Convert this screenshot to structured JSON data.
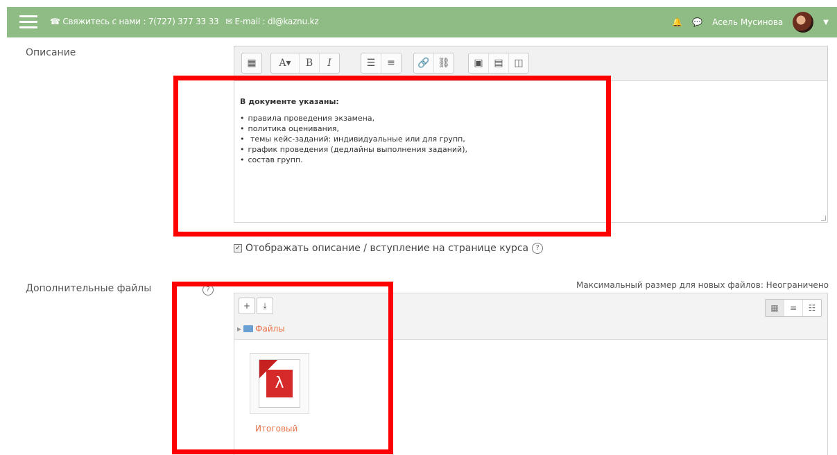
{
  "topbar": {
    "contact_text": "Свяжитесь с нами : 7(727) 377 33 33",
    "email_text": "E-mail : dl@kaznu.kz",
    "user_name": "Асель Мусинова"
  },
  "form": {
    "description_label": "Описание",
    "extra_files_label": "Дополнительные файлы",
    "show_description_label": "Отображать описание / вступление на странице курса",
    "max_size_text": "Максимальный размер для новых файлов: Неограничено"
  },
  "editor": {
    "content_heading": "В документе указаны:",
    "content_items": [
      "правила проведения экзамена,",
      "политика оценивания,",
      " темы кейс-заданий: индивидуальные или для групп,",
      "график проведения (дедлайны выполнения заданий),",
      "состав групп."
    ]
  },
  "file_manager": {
    "folder_label": "Файлы",
    "files": [
      {
        "name": "Итоговый",
        "icon": "pdf-icon"
      }
    ]
  },
  "colors": {
    "topbar": "#8fbc84",
    "highlight": "#ff0000",
    "link": "#e8734a"
  }
}
